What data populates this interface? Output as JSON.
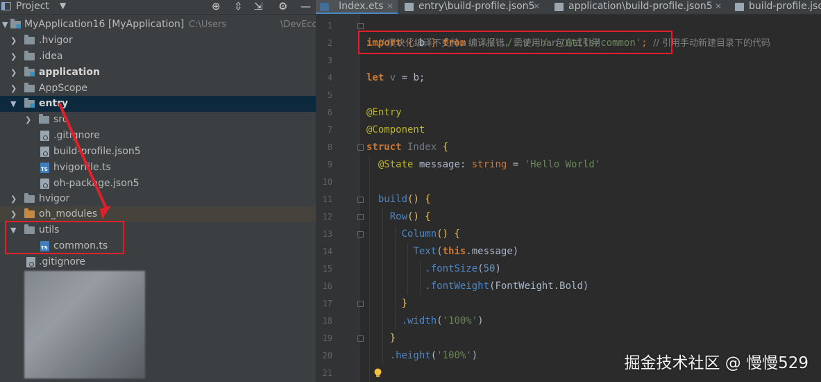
{
  "project_panel": {
    "title": "Project",
    "tree": [
      {
        "label": "MyApplication16 [MyApplication]",
        "path": "C:\\Users",
        "path2": "\\DevEco"
      },
      {
        "label": ".hvigor"
      },
      {
        "label": ".idea"
      },
      {
        "label": "application"
      },
      {
        "label": "AppScope"
      },
      {
        "label": "entry"
      },
      {
        "label": "src"
      },
      {
        "label": ".gitignore"
      },
      {
        "label": "build-profile.json5"
      },
      {
        "label": "hvigorfile.ts"
      },
      {
        "label": "oh-package.json5"
      },
      {
        "label": "hvigor"
      },
      {
        "label": "oh_modules"
      },
      {
        "label": "utils"
      },
      {
        "label": "common.ts"
      },
      {
        "label": ".gitignore"
      }
    ]
  },
  "editor": {
    "tabs": [
      {
        "label": "Index.ets",
        "active": true
      },
      {
        "label": "entry\\build-profile.json5"
      },
      {
        "label": "application\\build-profile.json5"
      },
      {
        "label": "build-profile.json"
      }
    ],
    "line_numbers": [
      "1",
      "2",
      "3",
      "4",
      "5",
      "6",
      "7",
      "8",
      "9",
      "10",
      "11",
      "12",
      "13",
      "14",
      "15",
      "16",
      "17",
      "18",
      "19",
      "20",
      "21"
    ],
    "code": {
      "l1": "// 模块化编译不支持，编译报错，需使用har包方式引用",
      "l2_import": "import",
      "l2_open": " { ",
      "l2_var": "b",
      "l2_close": " } ",
      "l2_from": "from",
      "l2_path": "'../../../../../utils/common'",
      "l2_semi": ";",
      "l2_comment": "// 引用手动新建目录下的代码",
      "l4_let": "let",
      "l4_var": " v",
      "l4_rest": " = b;",
      "l6": "@Entry",
      "l7": "@Component",
      "l8_struct": "struct",
      "l8_name": " Index",
      "l8_brace": " {",
      "l9_ann": "@State",
      "l9_prop": " message",
      "l9_colon": ": ",
      "l9_type": "string",
      "l9_eq": " = ",
      "l9_str": "'Hello World'",
      "l11_fn": "build",
      "l11_rest": "() {",
      "l12_fn": "Row",
      "l12_rest": "() {",
      "l13_fn": "Column",
      "l13_rest": "() {",
      "l14_fn": "Text",
      "l14_open": "(",
      "l14_this": "this",
      "l14_rest": ".message)",
      "l15_fn": ".fontSize",
      "l15_open": "(",
      "l15_num": "50",
      "l15_close": ")",
      "l16_fn": ".fontWeight",
      "l16_rest": "(FontWeight.Bold)",
      "l17": "}",
      "l18_fn": ".width",
      "l18_open": "(",
      "l18_str": "'100%'",
      "l18_close": ")",
      "l19": "}",
      "l20_fn": ".height",
      "l20_open": "(",
      "l20_str": "'100%'",
      "l20_close": ")"
    }
  },
  "watermark": "掘金技术社区 @ 慢慢529",
  "colors": {
    "highlight_box": "#e0202a",
    "selection": "#0d293e",
    "keyword": "#cc7832",
    "string": "#6a8759"
  }
}
